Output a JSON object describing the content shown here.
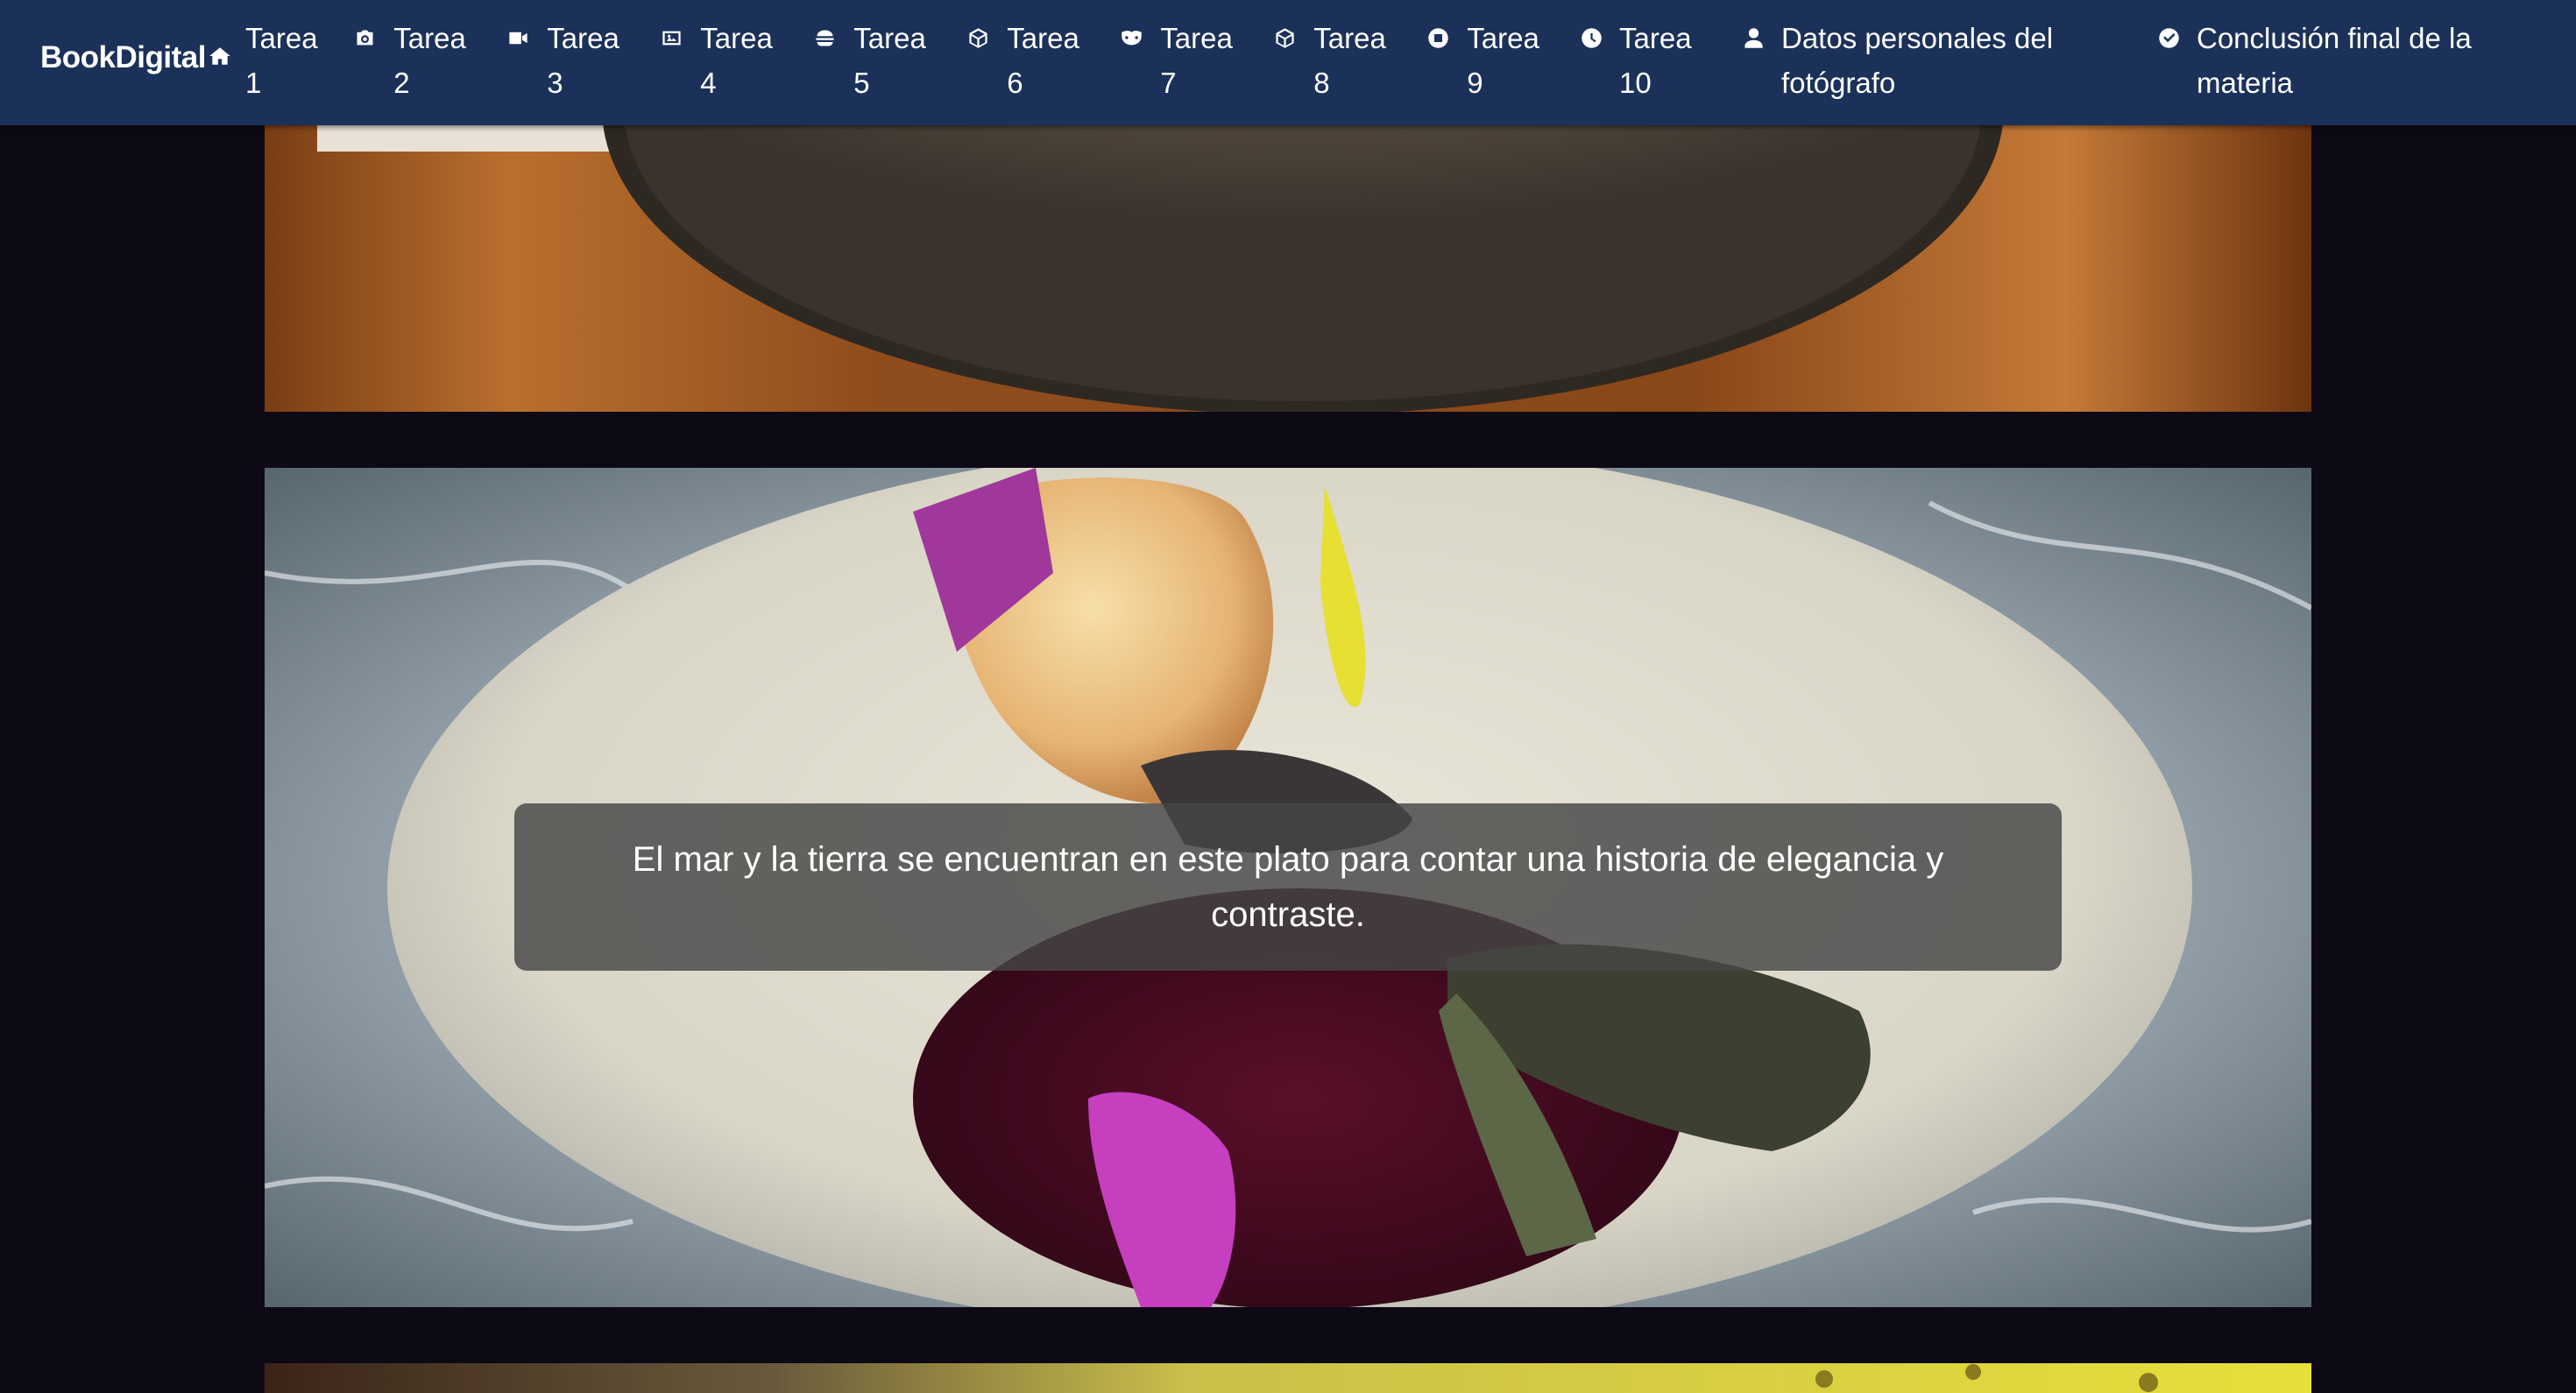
{
  "brand": {
    "name": "BookDigital",
    "icon": "home-icon"
  },
  "nav": {
    "items": [
      {
        "label": "Tarea 1",
        "icon": "none"
      },
      {
        "label": "Tarea 2",
        "icon": "camera-icon"
      },
      {
        "label": "Tarea 3",
        "icon": "video-icon"
      },
      {
        "label": "Tarea 4",
        "icon": "image-icon"
      },
      {
        "label": "Tarea 5",
        "icon": "hamburger-food-icon"
      },
      {
        "label": "Tarea 6",
        "icon": "box-icon"
      },
      {
        "label": "Tarea 7",
        "icon": "mask-icon"
      },
      {
        "label": "Tarea 8",
        "icon": "box-icon"
      },
      {
        "label": "Tarea 9",
        "icon": "stop-circle-icon"
      },
      {
        "label": "Tarea 10",
        "icon": "clock-icon"
      },
      {
        "label": "Datos personales del fotógrafo",
        "icon": "user-icon"
      },
      {
        "label": "Conclusión final de la materia",
        "icon": "check-circle-icon"
      }
    ]
  },
  "gallery": {
    "caption": "El mar y la tierra se encuentran en este plato para contar una historia de elegancia y contraste."
  },
  "colors": {
    "navbar": "#1b3159",
    "page_background": "#0d0a16",
    "caption_background": "#464646"
  }
}
